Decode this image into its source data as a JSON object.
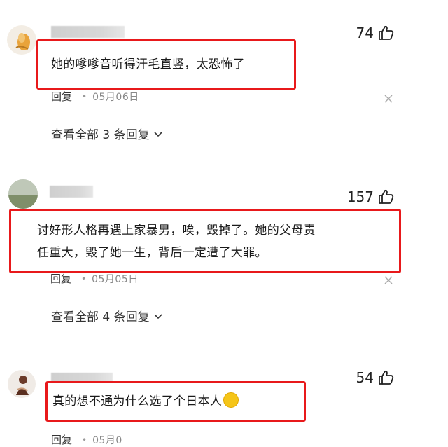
{
  "comments": [
    {
      "likes": "74",
      "lines": [
        "她的嗲嗲音听得汗毛直竖，太恐怖了"
      ],
      "reply_label": "回复",
      "date": "05月06日",
      "view_all": "查看全部 3 条回复"
    },
    {
      "likes": "157",
      "lines": [
        "讨好形人格再遇上家暴男，唉，毁掉了。她的父母责",
        "任重大，毁了她一生，背后一定遭了大罪。"
      ],
      "reply_label": "回复",
      "date": "05月05日",
      "view_all": "查看全部 4 条回复"
    },
    {
      "likes": "54",
      "lines": [
        "真的想不通为什么选了个日本人"
      ],
      "reply_label": "回复",
      "date": "05月0"
    }
  ],
  "colors": {
    "highlight_border": "#e8191b",
    "text": "#222222",
    "meta": "#888888"
  },
  "icons": [
    "thumbs-up-icon",
    "close-icon",
    "chevron-down-icon",
    "emoji-icon"
  ]
}
